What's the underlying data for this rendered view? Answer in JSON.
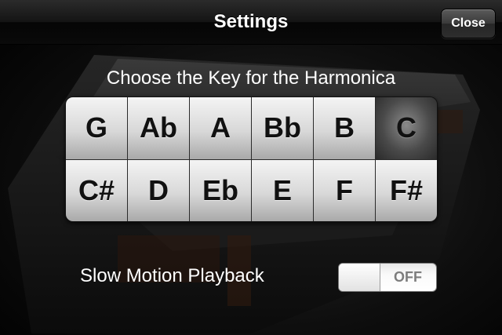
{
  "nav": {
    "title": "Settings",
    "close_label": "Close"
  },
  "key_section": {
    "label": "Choose the Key for the Harmonica",
    "keys": [
      "G",
      "Ab",
      "A",
      "Bb",
      "B",
      "C",
      "C#",
      "D",
      "Eb",
      "E",
      "F",
      "F#"
    ],
    "selected": "C"
  },
  "slow_motion": {
    "label": "Slow Motion Playback",
    "toggle_text": "OFF",
    "enabled": false
  },
  "colors": {
    "background": "#000000",
    "text": "#ffffff",
    "key_face": "#e0e0e0",
    "key_selected": "#4a4a4a"
  }
}
